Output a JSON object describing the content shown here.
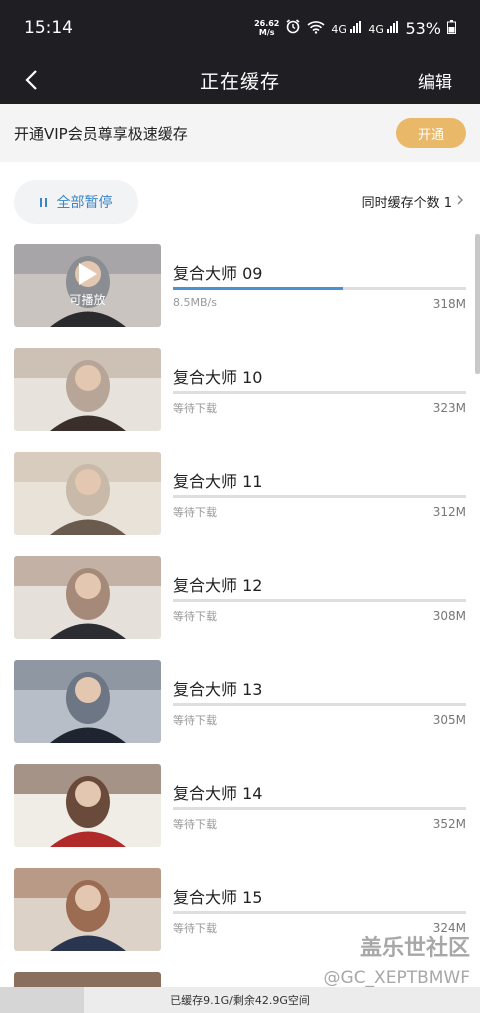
{
  "status_bar": {
    "time": "15:14",
    "net_speed_value": "26.62",
    "net_speed_unit": "M/s",
    "signal_1": "4G",
    "signal_2": "4G",
    "battery": "53%"
  },
  "nav": {
    "title": "正在缓存",
    "edit_label": "编辑",
    "back_icon": "chevron-left-icon"
  },
  "vip": {
    "text": "开通VIP会员尊享极速缓存",
    "button_label": "开通",
    "button_color": "#e9b868"
  },
  "controls": {
    "pause_all_label": "全部暂停",
    "concurrent_label": "同时缓存个数 1"
  },
  "downloads": [
    {
      "title": "复合大师 09",
      "status": "8.5MB/s",
      "size": "318M",
      "progress": 0.58,
      "overlay_label": "可播放",
      "thumb_colors": [
        "#2b2b2e",
        "#8a8d92",
        "#c9c4c0"
      ]
    },
    {
      "title": "复合大师 10",
      "status": "等待下载",
      "size": "323M",
      "progress": 0,
      "thumb_colors": [
        "#3a2f2a",
        "#b7a598",
        "#e8e2dc"
      ]
    },
    {
      "title": "复合大师 11",
      "status": "等待下载",
      "size": "312M",
      "progress": 0,
      "thumb_colors": [
        "#6b5a4e",
        "#c8b9a8",
        "#e9e2d8"
      ]
    },
    {
      "title": "复合大师 12",
      "status": "等待下载",
      "size": "308M",
      "progress": 0,
      "thumb_colors": [
        "#2c2d33",
        "#a58a7a",
        "#e6e0db"
      ]
    },
    {
      "title": "复合大师 13",
      "status": "等待下载",
      "size": "305M",
      "progress": 0,
      "thumb_colors": [
        "#1e2430",
        "#6c7684",
        "#b8bec7"
      ]
    },
    {
      "title": "复合大师 14",
      "status": "等待下载",
      "size": "352M",
      "progress": 0,
      "thumb_colors": [
        "#b02a2a",
        "#6a4a3a",
        "#f0ece6"
      ]
    },
    {
      "title": "复合大师 15",
      "status": "等待下载",
      "size": "324M",
      "progress": 0,
      "thumb_colors": [
        "#2a3550",
        "#9b6b52",
        "#dcd2c8"
      ]
    }
  ],
  "watermark": {
    "line1": "盖乐世社区",
    "line2": "@GC_XEPTBMWF"
  },
  "storage": {
    "text": "已缓存9.1G/剩余42.9G空间",
    "used_fraction": 0.175
  }
}
